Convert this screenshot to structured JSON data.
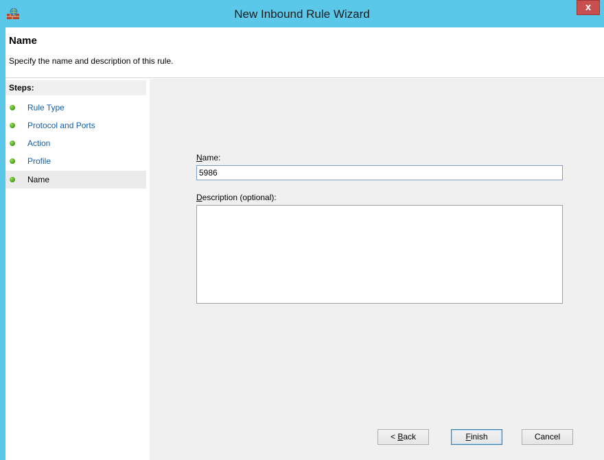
{
  "window": {
    "title": "New Inbound Rule Wizard",
    "close_glyph": "x",
    "app_icon": "firewall-wall-icon",
    "colors": {
      "titlebar": "#5bc8ea",
      "close": "#c74f4f",
      "panel": "#f0f0f0",
      "link": "#0f5ea8"
    }
  },
  "header": {
    "title": "Name",
    "subtitle": "Specify the name and description of this rule."
  },
  "steps": {
    "heading": "Steps:",
    "items": [
      {
        "label": "Rule Type"
      },
      {
        "label": "Protocol and Ports"
      },
      {
        "label": "Action"
      },
      {
        "label": "Profile"
      },
      {
        "label": "Name",
        "current": true
      }
    ]
  },
  "form": {
    "name_label_mnemonic": "N",
    "name_label_rest": "ame:",
    "name_value": "5986",
    "desc_label_mnemonic": "D",
    "desc_label_rest": "escription (optional):",
    "desc_value": ""
  },
  "buttons": {
    "back_prefix": "< ",
    "back_mnemonic": "B",
    "back_rest": "ack",
    "finish_mnemonic": "F",
    "finish_rest": "inish",
    "cancel": "Cancel"
  }
}
